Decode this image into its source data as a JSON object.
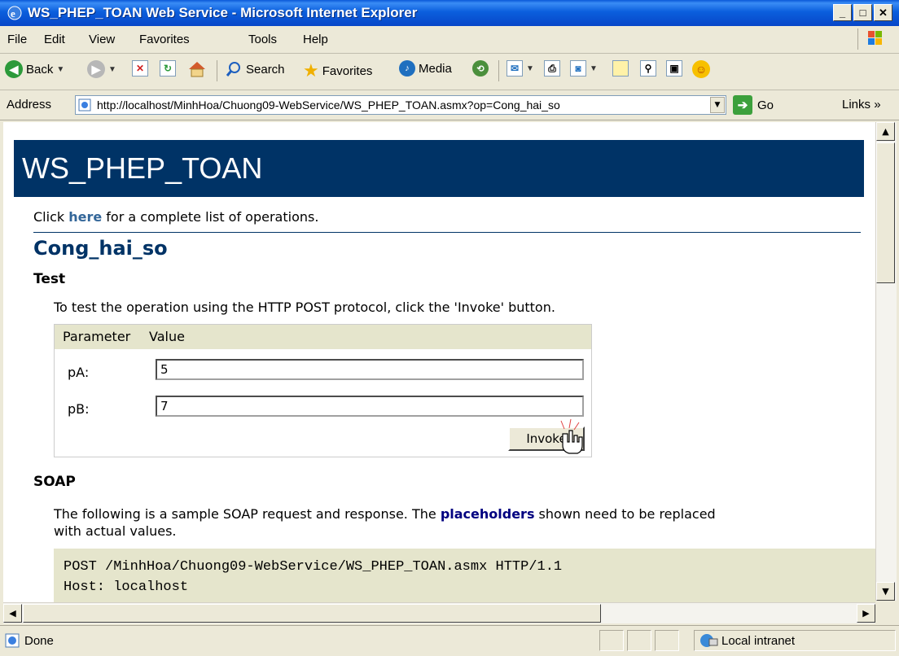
{
  "window": {
    "title": "WS_PHEP_TOAN Web Service - Microsoft Internet Explorer"
  },
  "menu": {
    "file": "File",
    "edit": "Edit",
    "view": "View",
    "favorites": "Favorites",
    "tools": "Tools",
    "help": "Help"
  },
  "toolbar": {
    "back": "Back",
    "search": "Search",
    "favorites": "Favorites",
    "media": "Media"
  },
  "address": {
    "label": "Address",
    "url": "http://localhost/MinhHoa/Chuong09-WebService/WS_PHEP_TOAN.asmx?op=Cong_hai_so",
    "go": "Go",
    "links": "Links"
  },
  "page": {
    "banner_title": "WS_PHEP_TOAN",
    "intro_before": "Click ",
    "intro_link": "here",
    "intro_after": " for a complete list of operations.",
    "operation_name": "Cong_hai_so",
    "test_heading": "Test",
    "test_description": "To test the operation using the HTTP POST protocol, click the 'Invoke' button.",
    "form": {
      "header_parameter": "Parameter",
      "header_value": "Value",
      "params": [
        {
          "label": "pA:",
          "value": "5"
        },
        {
          "label": "pB:",
          "value": "7"
        }
      ],
      "invoke_label": "Invoke"
    },
    "soap_heading": "SOAP",
    "soap_text_before": "The following is a sample SOAP request and response. The ",
    "soap_placeholders": "placeholders",
    "soap_text_after": " shown need to be replaced",
    "soap_text_line2": "with actual values.",
    "code_line1": "POST /MinhHoa/Chuong09-WebService/WS_PHEP_TOAN.asmx HTTP/1.1",
    "code_line2": "Host: localhost"
  },
  "status": {
    "text": "Done",
    "zone": "Local intranet"
  }
}
